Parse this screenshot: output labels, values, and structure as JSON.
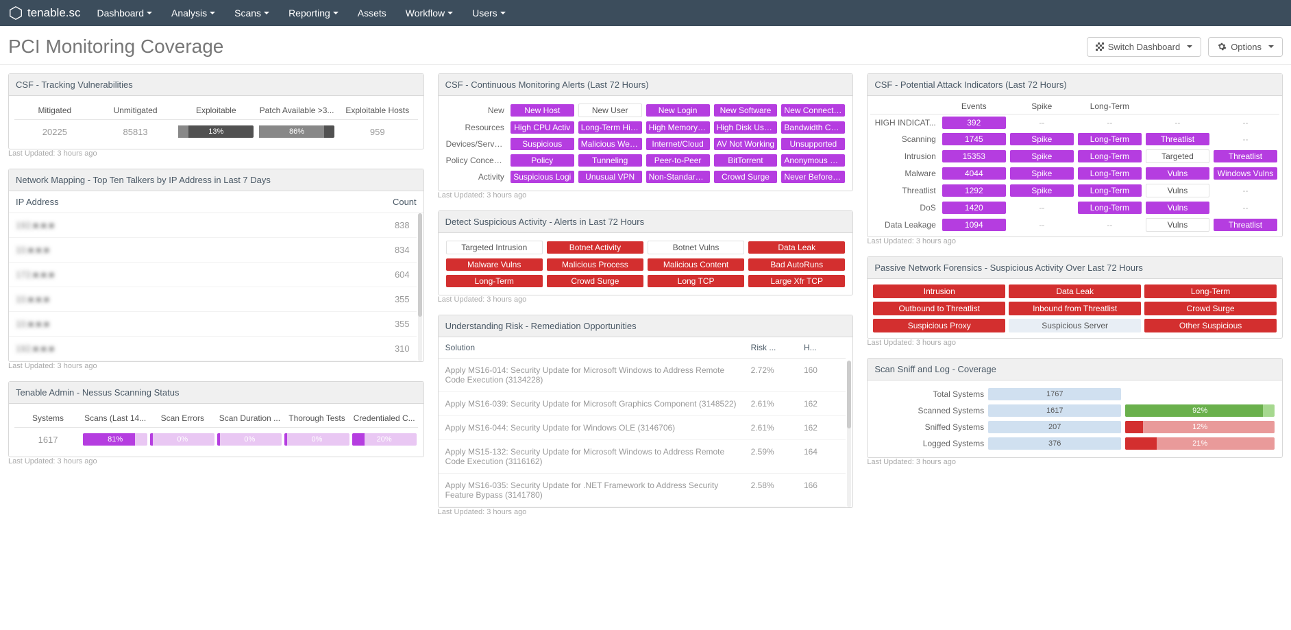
{
  "brand": "tenable.sc",
  "nav": [
    "Dashboard",
    "Analysis",
    "Scans",
    "Reporting",
    "Assets",
    "Workflow",
    "Users"
  ],
  "nav_caret": [
    true,
    true,
    true,
    true,
    false,
    true,
    true
  ],
  "page_title": "PCI Monitoring Coverage",
  "switch_btn": "Switch Dashboard",
  "options_btn": "Options",
  "updated": "Last Updated: 3 hours ago",
  "panels": {
    "tracking": {
      "title": "CSF - Tracking Vulnerabilities",
      "headers": [
        "Mitigated",
        "Unmitigated",
        "Exploitable",
        "Patch Available >3...",
        "Exploitable Hosts"
      ],
      "values": {
        "mitigated": "20225",
        "unmitigated": "85813",
        "exploitable_pct": "13%",
        "exploitable_w": "13%",
        "patch_pct": "86%",
        "patch_w": "86%",
        "hosts": "959"
      }
    },
    "talkers": {
      "title": "Network Mapping - Top Ten Talkers by IP Address in Last 7 Days",
      "ip_hdr": "IP Address",
      "count_hdr": "Count",
      "rows": [
        {
          "ip": "192.■.■.■",
          "count": "838"
        },
        {
          "ip": "10.■.■.■",
          "count": "834"
        },
        {
          "ip": "172.■.■.■",
          "count": "604"
        },
        {
          "ip": "10.■.■.■",
          "count": "355"
        },
        {
          "ip": "10.■.■.■",
          "count": "355"
        },
        {
          "ip": "192.■.■.■",
          "count": "310"
        }
      ]
    },
    "scanning": {
      "title": "Tenable Admin - Nessus Scanning Status",
      "headers": [
        "Systems",
        "Scans (Last 14...",
        "Scan Errors",
        "Scan Duration ...",
        "Thorough Tests",
        "Credentialed C..."
      ],
      "systems": "1617",
      "bars": [
        {
          "pct": "81%",
          "w": "81%"
        },
        {
          "pct": "0%",
          "w": "4%"
        },
        {
          "pct": "0%",
          "w": "4%"
        },
        {
          "pct": "0%",
          "w": "4%"
        },
        {
          "pct": "20%",
          "w": "20%"
        }
      ]
    },
    "alerts": {
      "title": "CSF - Continuous Monitoring Alerts (Last 72 Hours)",
      "rows": [
        {
          "label": "New",
          "cells": [
            {
              "t": "New Host",
              "c": "purple"
            },
            {
              "t": "New User",
              "c": "plain"
            },
            {
              "t": "New Login",
              "c": "purple"
            },
            {
              "t": "New Software",
              "c": "purple"
            },
            {
              "t": "New Connection",
              "c": "purple"
            }
          ]
        },
        {
          "label": "Resources",
          "cells": [
            {
              "t": "High CPU Activ",
              "c": "purple"
            },
            {
              "t": "Long-Term High",
              "c": "purple"
            },
            {
              "t": "High Memory Us",
              "c": "purple"
            },
            {
              "t": "High Disk Usage",
              "c": "purple"
            },
            {
              "t": "Bandwidth Cond",
              "c": "purple"
            }
          ]
        },
        {
          "label": "Devices/Servic...",
          "cells": [
            {
              "t": "Suspicious",
              "c": "purple"
            },
            {
              "t": "Malicious Web C",
              "c": "purple"
            },
            {
              "t": "Internet/Cloud",
              "c": "purple"
            },
            {
              "t": "AV Not Working",
              "c": "purple"
            },
            {
              "t": "Unsupported",
              "c": "purple"
            }
          ]
        },
        {
          "label": "Policy Concerns",
          "cells": [
            {
              "t": "Policy",
              "c": "purple"
            },
            {
              "t": "Tunneling",
              "c": "purple"
            },
            {
              "t": "Peer-to-Peer",
              "c": "purple"
            },
            {
              "t": "BitTorrent",
              "c": "purple"
            },
            {
              "t": "Anonymous FTP",
              "c": "purple"
            }
          ]
        },
        {
          "label": "Activity",
          "cells": [
            {
              "t": "Suspicious Logi",
              "c": "purple"
            },
            {
              "t": "Unusual VPN",
              "c": "purple"
            },
            {
              "t": "Non-Standard T",
              "c": "purple"
            },
            {
              "t": "Crowd Surge",
              "c": "purple"
            },
            {
              "t": "Never Before Se",
              "c": "purple"
            }
          ]
        }
      ]
    },
    "suspicious": {
      "title": "Detect Suspicious Activity - Alerts in Last 72 Hours",
      "rows": [
        [
          {
            "t": "Targeted Intrusion",
            "c": "plain"
          },
          {
            "t": "Botnet Activity",
            "c": "red"
          },
          {
            "t": "Botnet Vulns",
            "c": "plain"
          },
          {
            "t": "Data Leak",
            "c": "red"
          }
        ],
        [
          {
            "t": "Malware Vulns",
            "c": "red"
          },
          {
            "t": "Malicious Process",
            "c": "red"
          },
          {
            "t": "Malicious Content",
            "c": "red"
          },
          {
            "t": "Bad AutoRuns",
            "c": "red"
          }
        ],
        [
          {
            "t": "Long-Term",
            "c": "red"
          },
          {
            "t": "Crowd Surge",
            "c": "red"
          },
          {
            "t": "Long TCP",
            "c": "red"
          },
          {
            "t": "Large Xfr TCP",
            "c": "red"
          }
        ]
      ]
    },
    "risk": {
      "title": "Understanding Risk - Remediation Opportunities",
      "headers": [
        "Solution",
        "Risk ...",
        "H..."
      ],
      "rows": [
        {
          "sol": "Apply MS16-014: Security Update for Microsoft Windows to Address Remote Code Execution (3134228)",
          "risk": "2.72%",
          "h": "160"
        },
        {
          "sol": "Apply MS16-039: Security Update for Microsoft Graphics Component (3148522)",
          "risk": "2.61%",
          "h": "162"
        },
        {
          "sol": "Apply MS16-044: Security Update for Windows OLE (3146706)",
          "risk": "2.61%",
          "h": "162"
        },
        {
          "sol": "Apply MS15-132: Security Update for Microsoft Windows to Address Remote Code Execution (3116162)",
          "risk": "2.59%",
          "h": "164"
        },
        {
          "sol": "Apply MS16-035: Security Update for .NET Framework to Address Security Feature Bypass (3141780)",
          "risk": "2.58%",
          "h": "166"
        }
      ]
    },
    "indicators": {
      "title": "CSF - Potential Attack Indicators (Last 72 Hours)",
      "headers": [
        "",
        "Events",
        "Spike",
        "Long-Term",
        "",
        ""
      ],
      "rows": [
        {
          "label": "HIGH INDICAT...",
          "cells": [
            {
              "t": "392",
              "c": "purple"
            },
            {
              "t": "--",
              "c": "dash"
            },
            {
              "t": "--",
              "c": "dash"
            },
            {
              "t": "--",
              "c": "dash"
            },
            {
              "t": "--",
              "c": "dash"
            }
          ]
        },
        {
          "label": "Scanning",
          "cells": [
            {
              "t": "1745",
              "c": "purple"
            },
            {
              "t": "Spike",
              "c": "purple"
            },
            {
              "t": "Long-Term",
              "c": "purple"
            },
            {
              "t": "Threatlist",
              "c": "purple"
            },
            {
              "t": "--",
              "c": "dash"
            }
          ]
        },
        {
          "label": "Intrusion",
          "cells": [
            {
              "t": "15353",
              "c": "purple"
            },
            {
              "t": "Spike",
              "c": "purple"
            },
            {
              "t": "Long-Term",
              "c": "purple"
            },
            {
              "t": "Targeted",
              "c": "plain"
            },
            {
              "t": "Threatlist",
              "c": "purple"
            }
          ]
        },
        {
          "label": "Malware",
          "cells": [
            {
              "t": "4044",
              "c": "purple"
            },
            {
              "t": "Spike",
              "c": "purple"
            },
            {
              "t": "Long-Term",
              "c": "purple"
            },
            {
              "t": "Vulns",
              "c": "purple"
            },
            {
              "t": "Windows Vulns",
              "c": "purple"
            }
          ]
        },
        {
          "label": "Threatlist",
          "cells": [
            {
              "t": "1292",
              "c": "purple"
            },
            {
              "t": "Spike",
              "c": "purple"
            },
            {
              "t": "Long-Term",
              "c": "purple"
            },
            {
              "t": "Vulns",
              "c": "plain"
            },
            {
              "t": "--",
              "c": "dash"
            }
          ]
        },
        {
          "label": "DoS",
          "cells": [
            {
              "t": "1420",
              "c": "purple"
            },
            {
              "t": "--",
              "c": "dash"
            },
            {
              "t": "Long-Term",
              "c": "purple"
            },
            {
              "t": "Vulns",
              "c": "purple"
            },
            {
              "t": "--",
              "c": "dash"
            }
          ]
        },
        {
          "label": "Data Leakage",
          "cells": [
            {
              "t": "1094",
              "c": "purple"
            },
            {
              "t": "--",
              "c": "dash"
            },
            {
              "t": "--",
              "c": "dash"
            },
            {
              "t": "Vulns",
              "c": "plain"
            },
            {
              "t": "Threatlist",
              "c": "purple"
            }
          ]
        }
      ]
    },
    "forensics": {
      "title": "Passive Network Forensics - Suspicious Activity Over Last 72 Hours",
      "cells": [
        {
          "t": "Intrusion",
          "c": "red"
        },
        {
          "t": "Data Leak",
          "c": "red"
        },
        {
          "t": "Long-Term",
          "c": "red"
        },
        {
          "t": "Outbound to Threatlist",
          "c": "red"
        },
        {
          "t": "Inbound from Threatlist",
          "c": "red"
        },
        {
          "t": "Crowd Surge",
          "c": "red"
        },
        {
          "t": "Suspicious Proxy",
          "c": "red"
        },
        {
          "t": "Suspicious Server",
          "c": "light"
        },
        {
          "t": "Other Suspicious",
          "c": "red"
        }
      ]
    },
    "coverage": {
      "title": "Scan Sniff and Log - Coverage",
      "rows": [
        {
          "label": "Total Systems",
          "val": "1767",
          "bar": null
        },
        {
          "label": "Scanned Systems",
          "val": "1617",
          "bar": {
            "pct": "92%",
            "w": "92%",
            "kind": "green"
          }
        },
        {
          "label": "Sniffed Systems",
          "val": "207",
          "bar": {
            "pct": "12%",
            "w": "12%",
            "kind": "red"
          }
        },
        {
          "label": "Logged Systems",
          "val": "376",
          "bar": {
            "pct": "21%",
            "w": "21%",
            "kind": "red"
          }
        }
      ]
    }
  }
}
